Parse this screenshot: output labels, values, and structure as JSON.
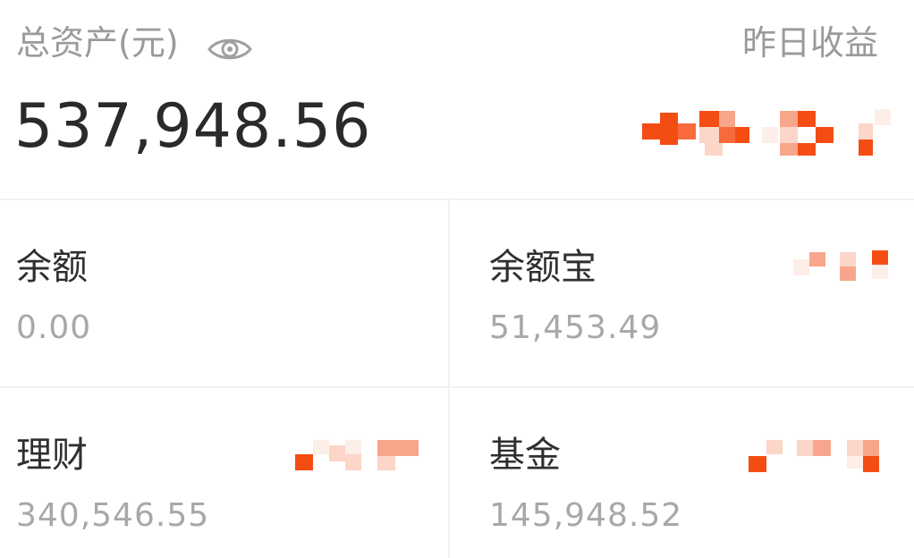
{
  "header": {
    "total_assets_label": "总资产(元)",
    "eye_icon": "eye-icon",
    "yesterday_income_label": "昨日收益",
    "total_assets_value": "537,948.56"
  },
  "accounts": [
    {
      "title": "余额",
      "value": "0.00"
    },
    {
      "title": "余额宝",
      "value": "51,453.49"
    },
    {
      "title": "理财",
      "value": "340,546.55"
    },
    {
      "title": "基金",
      "value": "145,948.52"
    }
  ],
  "colors": {
    "mosaic_strong": "#f44d14",
    "mosaic_mid": "#f7a68c",
    "mosaic_light": "#fbd6c9",
    "mosaic_faint": "#fdeee8"
  }
}
